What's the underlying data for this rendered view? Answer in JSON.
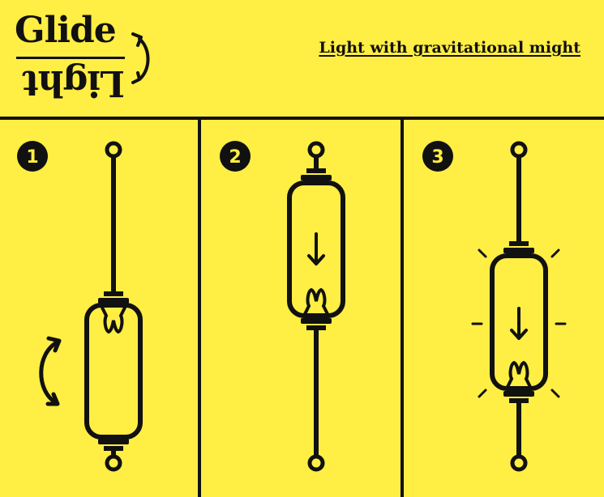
{
  "header": {
    "logo_top": "Glide",
    "logo_bottom": "Light",
    "tagline": "Light with gravitational might"
  },
  "steps": [
    {
      "number": "1"
    },
    {
      "number": "2"
    },
    {
      "number": "3"
    }
  ],
  "colors": {
    "background": "#FFEE44",
    "ink": "#111111"
  },
  "icons": [
    "rotate-arrow-icon",
    "down-arrow-icon",
    "flip-arrow-icon",
    "glow-rays-icon"
  ]
}
